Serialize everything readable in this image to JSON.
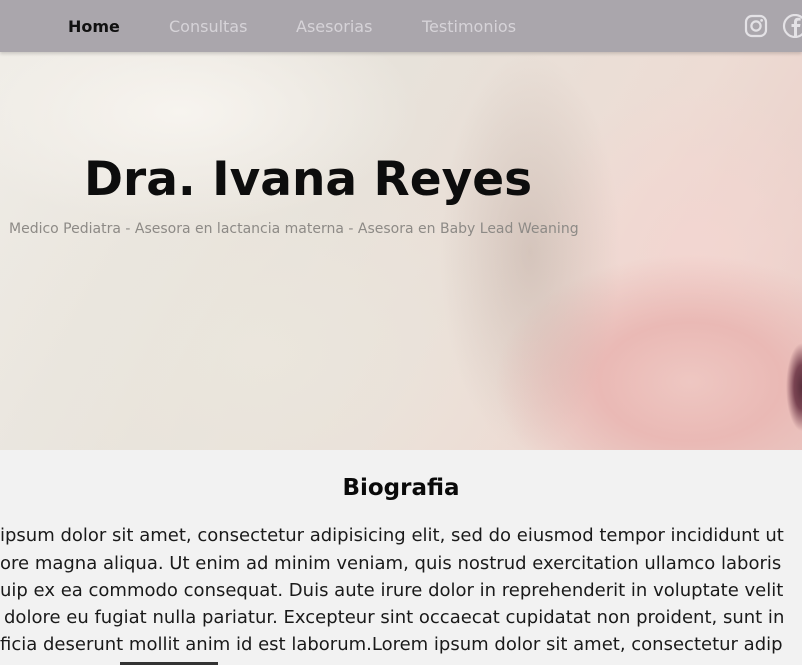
{
  "nav": {
    "items": [
      {
        "label": "Home",
        "active": true
      },
      {
        "label": "Consultas",
        "active": false
      },
      {
        "label": "Asesorias",
        "active": false
      },
      {
        "label": "Testimonios",
        "active": false
      }
    ],
    "social": [
      {
        "icon": "instagram-icon"
      },
      {
        "icon": "facebook-icon"
      }
    ]
  },
  "hero": {
    "title": "Dra. Ivana Reyes",
    "subtitle": "Medico Pediatra - Asesora en lactancia materna - Asesora en Baby Lead Weaning"
  },
  "bio": {
    "heading": "Biografia",
    "lines": [
      "ipsum dolor sit amet, consectetur adipisicing elit, sed do eiusmod tempor incididunt ut",
      "ore magna aliqua. Ut enim ad minim veniam, quis nostrud exercitation ullamco laboris",
      "uip ex ea commodo consequat. Duis aute irure dolor in reprehenderit in voluptate velit",
      "dolore eu fugiat nulla pariatur. Excepteur sint occaecat cupidatat non proident, sunt in",
      "ficia deserunt mollit anim id est laborum.Lorem ipsum dolor sit amet, consectetur adip"
    ]
  },
  "colors": {
    "navbar": "#aaa6ac",
    "nav_inactive": "#d6d3d8",
    "nav_active": "#111111",
    "page_bg": "#f2f2f2"
  }
}
